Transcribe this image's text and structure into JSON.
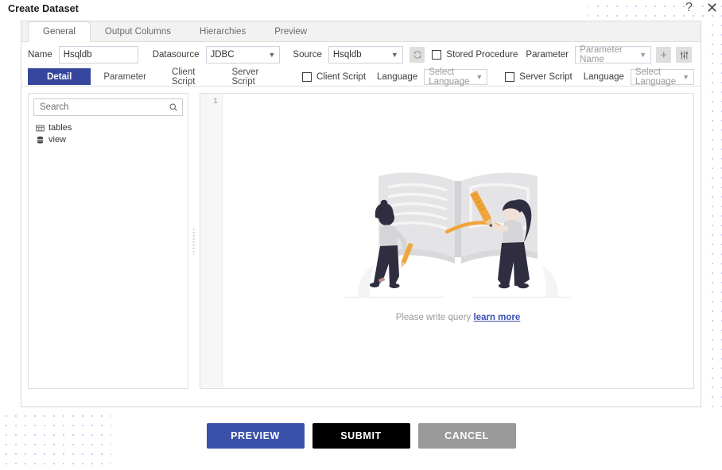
{
  "window": {
    "title": "Create Dataset",
    "help_icon": "?",
    "close_icon": "✕"
  },
  "tabs": [
    {
      "label": "General",
      "active": true
    },
    {
      "label": "Output Columns",
      "active": false
    },
    {
      "label": "Hierarchies",
      "active": false
    },
    {
      "label": "Preview",
      "active": false
    }
  ],
  "form": {
    "name_label": "Name",
    "name_value": "Hsqldb",
    "name_placeholder": "",
    "datasource_label": "Datasource",
    "datasource_value": "JDBC",
    "source_label": "Source",
    "source_value": "Hsqldb",
    "refresh_icon": "refresh-icon",
    "stored_procedure_label": "Stored Procedure",
    "stored_procedure_checked": false,
    "parameter_label": "Parameter",
    "parameter_name_placeholder": "Parameter Name",
    "add_icon": "+",
    "settings_icon": "sliders-icon"
  },
  "subtabs": [
    {
      "label": "Detail",
      "active": true
    },
    {
      "label": "Parameter",
      "active": false
    },
    {
      "label": "Client Script",
      "active": false
    },
    {
      "label": "Server Script",
      "active": false
    }
  ],
  "scripts": {
    "client_script_label": "Client Script",
    "client_script_checked": false,
    "client_language_label": "Language",
    "client_language_value": "Select Language",
    "server_script_label": "Server Script",
    "server_script_checked": false,
    "server_language_label": "Language",
    "server_language_value": "Select Language"
  },
  "left_pane": {
    "search_placeholder": "Search",
    "search_value": "",
    "search_icon": "search-icon",
    "tree": [
      {
        "label": "tables",
        "icon": "table-icon"
      },
      {
        "label": "view",
        "icon": "database-icon"
      }
    ]
  },
  "editor": {
    "line_numbers": "1",
    "empty_text": "Please write query",
    "empty_link": "learn more"
  },
  "footer": {
    "preview_label": "PREVIEW",
    "submit_label": "SUBMIT",
    "cancel_label": "CANCEL"
  },
  "colors": {
    "accent_blue": "#36469c",
    "preview_blue": "#3b50a8",
    "submit_black": "#000000",
    "cancel_gray": "#9a9a9a",
    "dot_pattern": "#c8cbee",
    "illustration_gray": "#e4e4e6",
    "illustration_dark": "#2f2e41",
    "illustration_orange": "#f0a63c"
  }
}
